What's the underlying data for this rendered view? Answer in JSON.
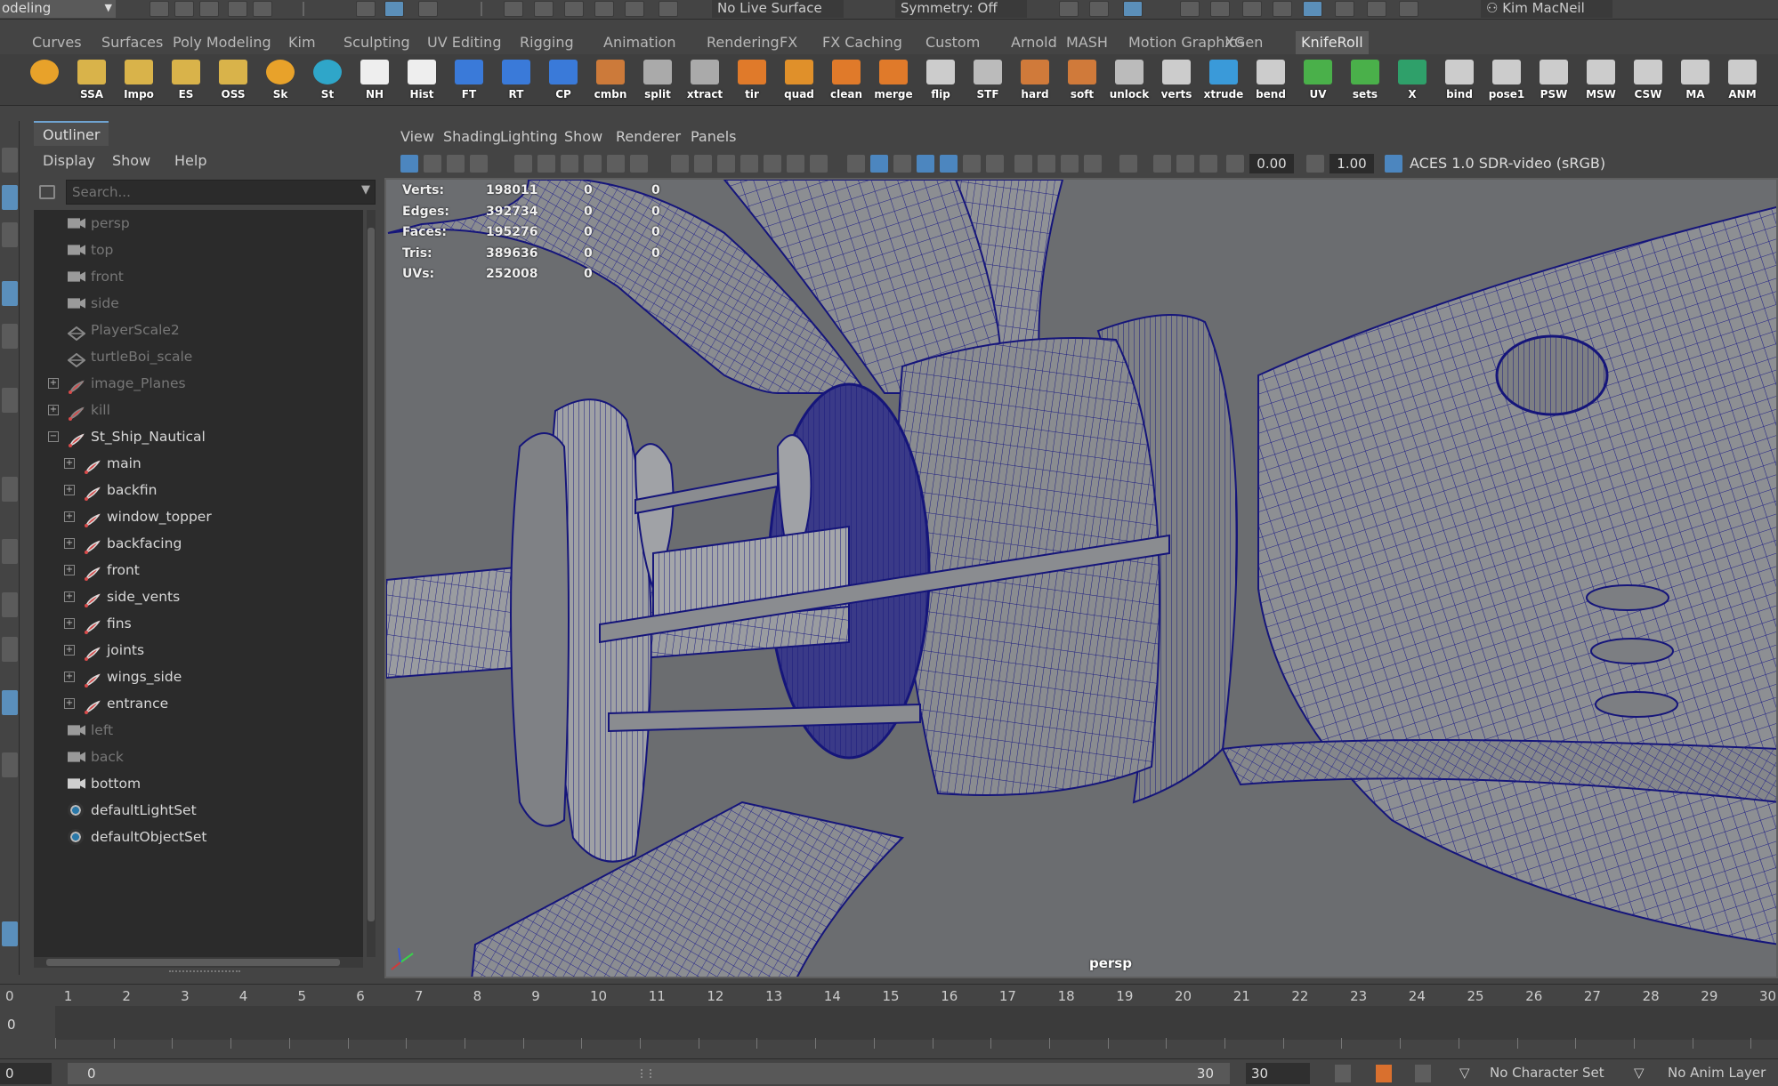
{
  "status_line": {
    "mode": "odeling",
    "live_surface": "No Live Surface",
    "symmetry": "Symmetry: Off",
    "user": "Kim MacNeil"
  },
  "shelf_tabs": [
    "Curves",
    "Surfaces",
    "Poly Modeling",
    "Kim",
    "Sculpting",
    "UV Editing",
    "Rigging",
    "Animation",
    "Rendering",
    "FX",
    "FX Caching",
    "Custom",
    "Arnold",
    "MASH",
    "Motion Graphics",
    "XGen",
    "KnifeRoll"
  ],
  "shelf_active_tab": "KnifeRoll",
  "shelf_buttons": [
    "",
    "SSA",
    "Impo",
    "ES",
    "OSS",
    "Sk",
    "St",
    "NH",
    "Hist",
    "FT",
    "RT",
    "CP",
    "cmbn",
    "split",
    "xtract",
    "tir",
    "quad",
    "clean",
    "merge",
    "flip",
    "STF",
    "hard",
    "soft",
    "unlock",
    "verts",
    "xtrude",
    "bend",
    "UV",
    "sets",
    "X",
    "bind",
    "pose1",
    "PSW",
    "MSW",
    "CSW",
    "MA",
    "ANM"
  ],
  "outliner": {
    "title": "Outliner",
    "menu": [
      "Display",
      "Show",
      "Help"
    ],
    "search_placeholder": "Search...",
    "items": [
      {
        "label": "persp",
        "type": "camera",
        "dim": true,
        "indent": 0,
        "expand": ""
      },
      {
        "label": "top",
        "type": "camera",
        "dim": true,
        "indent": 0,
        "expand": ""
      },
      {
        "label": "front",
        "type": "camera",
        "dim": true,
        "indent": 0,
        "expand": ""
      },
      {
        "label": "side",
        "type": "camera",
        "dim": true,
        "indent": 0,
        "expand": ""
      },
      {
        "label": "PlayerScale2",
        "type": "mesh",
        "dim": true,
        "indent": 0,
        "expand": ""
      },
      {
        "label": "turtleBoi_scale",
        "type": "mesh",
        "dim": true,
        "indent": 0,
        "expand": ""
      },
      {
        "label": "image_Planes",
        "type": "group",
        "dim": true,
        "indent": 0,
        "expand": "+"
      },
      {
        "label": "kill",
        "type": "group",
        "dim": true,
        "indent": 0,
        "expand": "+"
      },
      {
        "label": "St_Ship_Nautical",
        "type": "group",
        "dim": false,
        "indent": 0,
        "expand": "-"
      },
      {
        "label": "main",
        "type": "group",
        "dim": false,
        "indent": 1,
        "expand": "+"
      },
      {
        "label": "backfin",
        "type": "group",
        "dim": false,
        "indent": 1,
        "expand": "+"
      },
      {
        "label": "window_topper",
        "type": "group",
        "dim": false,
        "indent": 1,
        "expand": "+"
      },
      {
        "label": "backfacing",
        "type": "group",
        "dim": false,
        "indent": 1,
        "expand": "+"
      },
      {
        "label": "front",
        "type": "group",
        "dim": false,
        "indent": 1,
        "expand": "+"
      },
      {
        "label": "side_vents",
        "type": "group",
        "dim": false,
        "indent": 1,
        "expand": "+"
      },
      {
        "label": "fins",
        "type": "group",
        "dim": false,
        "indent": 1,
        "expand": "+"
      },
      {
        "label": "joints",
        "type": "group",
        "dim": false,
        "indent": 1,
        "expand": "+"
      },
      {
        "label": "wings_side",
        "type": "group",
        "dim": false,
        "indent": 1,
        "expand": "+"
      },
      {
        "label": "entrance",
        "type": "group",
        "dim": false,
        "indent": 1,
        "expand": "+"
      },
      {
        "label": "left",
        "type": "camera",
        "dim": true,
        "indent": 0,
        "expand": ""
      },
      {
        "label": "back",
        "type": "camera",
        "dim": true,
        "indent": 0,
        "expand": ""
      },
      {
        "label": "bottom",
        "type": "camera",
        "dim": false,
        "indent": 0,
        "expand": ""
      },
      {
        "label": "defaultLightSet",
        "type": "set",
        "dim": false,
        "indent": 0,
        "expand": ""
      },
      {
        "label": "defaultObjectSet",
        "type": "set",
        "dim": false,
        "indent": 0,
        "expand": ""
      }
    ]
  },
  "panel_menu": [
    "View",
    "Shading",
    "Lighting",
    "Show",
    "Renderer",
    "Panels"
  ],
  "panel_toolbar": {
    "exposure": "0.00",
    "gamma": "1.00",
    "color_space": "ACES 1.0 SDR-video (sRGB)"
  },
  "hud": {
    "rows": [
      {
        "label": "Verts:",
        "total": "198011",
        "sel": "0",
        "uv": "0"
      },
      {
        "label": "Edges:",
        "total": "392734",
        "sel": "0",
        "uv": "0"
      },
      {
        "label": "Faces:",
        "total": "195276",
        "sel": "0",
        "uv": "0"
      },
      {
        "label": "Tris:",
        "total": "389636",
        "sel": "0",
        "uv": "0"
      },
      {
        "label": "UVs:",
        "total": "252008",
        "sel": "0",
        "uv": ""
      }
    ],
    "camera": "persp"
  },
  "timeline": {
    "frames": [
      "0",
      "1",
      "2",
      "3",
      "4",
      "5",
      "6",
      "7",
      "8",
      "9",
      "10",
      "11",
      "12",
      "13",
      "14",
      "15",
      "16",
      "17",
      "18",
      "19",
      "20",
      "21",
      "22",
      "23",
      "24",
      "25",
      "26",
      "27",
      "28",
      "29",
      "30"
    ],
    "current_frame": "0"
  },
  "range": {
    "start": "0",
    "slider_start": "0",
    "slider_end": "30",
    "end": "30",
    "character_set": "No Character Set",
    "anim_layer": "No Anim Layer"
  },
  "colors": {
    "wire": "#1a1a7a",
    "viewport_bg": "#6b6d70",
    "accent": "#5b8fb9"
  }
}
